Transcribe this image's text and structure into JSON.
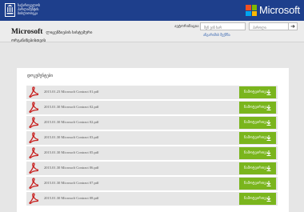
{
  "header": {
    "gov_text": "საქართველოს პარლამენტის ბიბლიოთეკა",
    "microsoft_word": "Microsoft",
    "ms_colors": [
      "#f25022",
      "#7fba00",
      "#00a4ef",
      "#ffb900"
    ]
  },
  "subheader": {
    "brand": "Microsoft",
    "title_rest": "ლიცენზიების სისტემური",
    "title_line2": "ორგანიზებისთვის",
    "auth_label": "ავტორიზაცია",
    "username_placeholder": "შენ ვინ ხარ",
    "password_placeholder": "პაროლი",
    "go_symbol": "➜",
    "register_link": "ანგარიშის შექმნა"
  },
  "main": {
    "section_title": "დოკუმენტები",
    "download_label": "ჩამოტვირთვა",
    "files": [
      {
        "name": "2015.01.23 Microsoft Contract 01.pdf"
      },
      {
        "name": "2015.01.30 Microsoft Contract 02.pdf"
      },
      {
        "name": "2015.01.30 Microsoft Contract 02.pdf"
      },
      {
        "name": "2015.01.30 Microsoft Contract 03.pdf"
      },
      {
        "name": "2015.01.30 Microsoft Contract 05.pdf"
      },
      {
        "name": "2015.01.30 Microsoft Contract 06.pdf"
      },
      {
        "name": "2015.01.30 Microsoft Contract 07.pdf"
      },
      {
        "name": "2015.01.30 Microsoft Contract 08.pdf"
      }
    ]
  }
}
